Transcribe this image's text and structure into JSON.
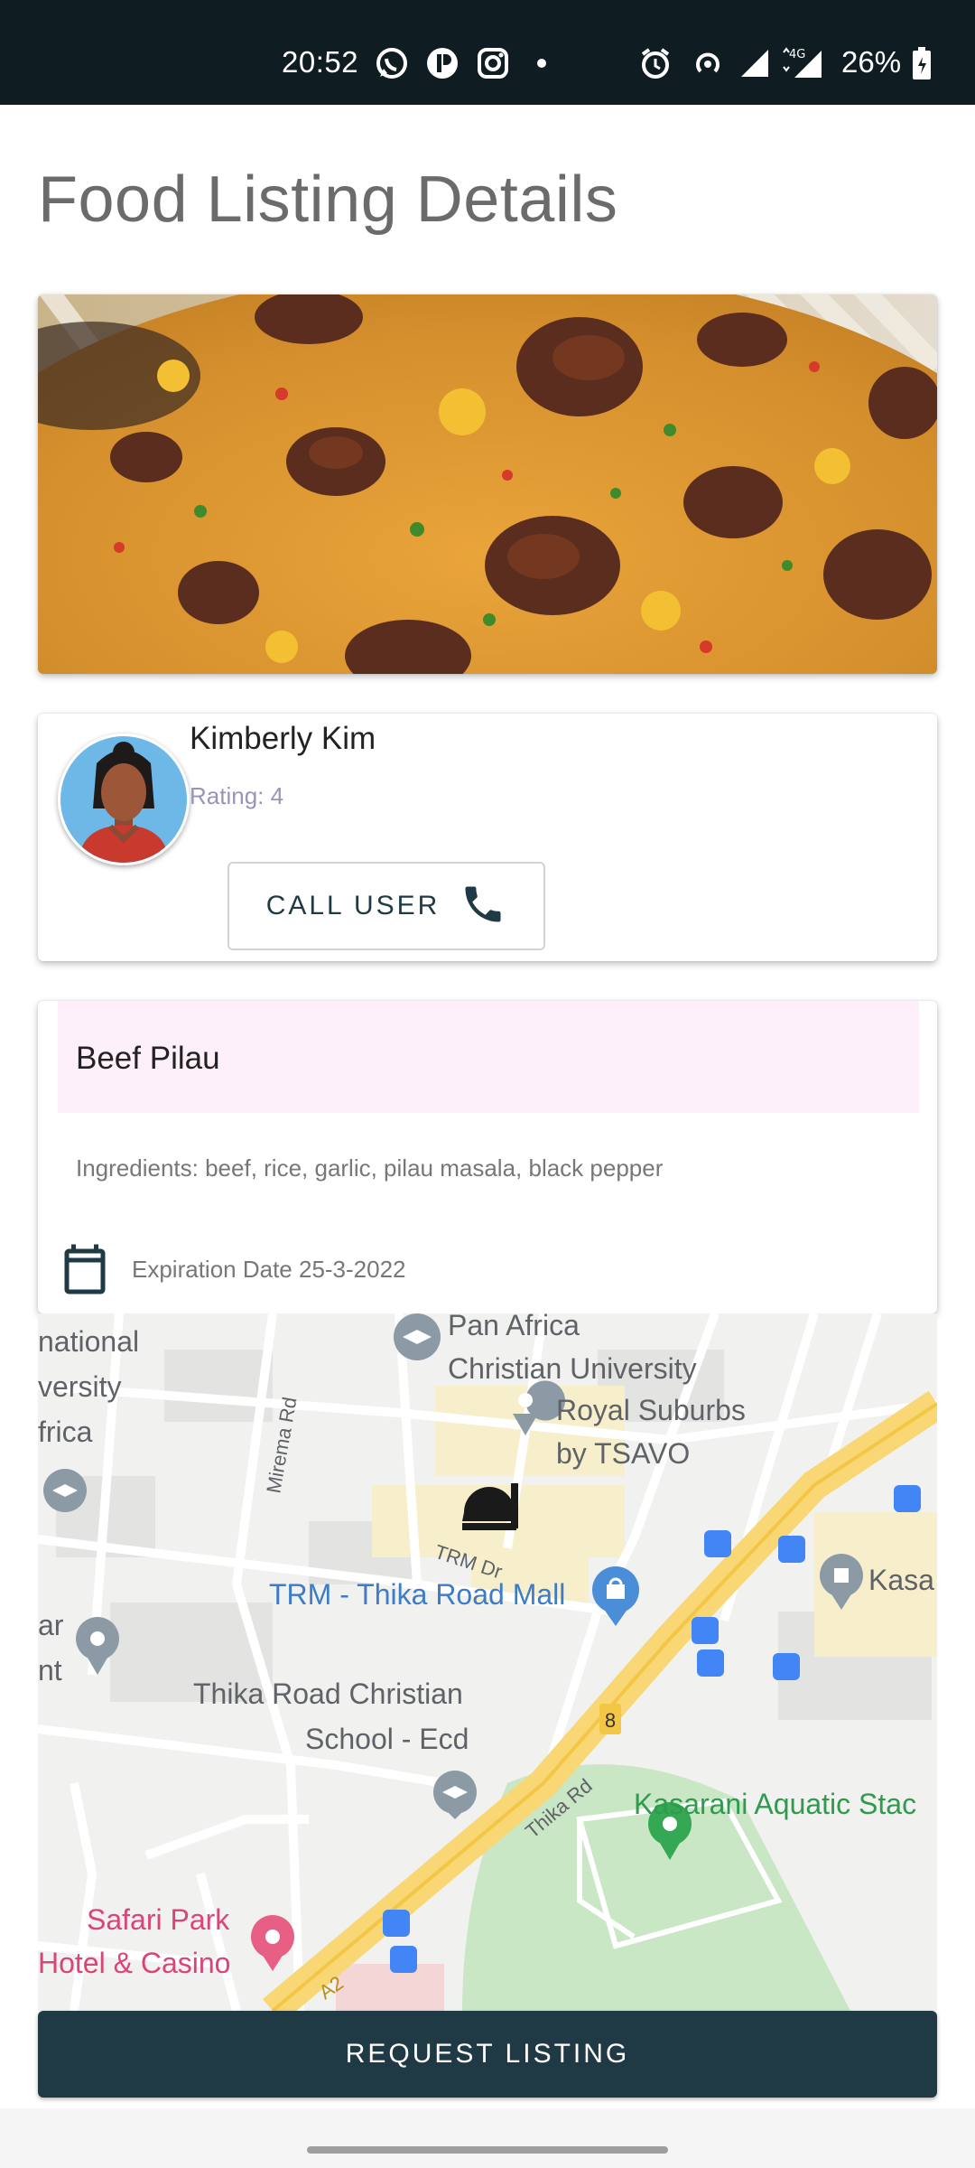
{
  "status_bar": {
    "time": "20:52",
    "battery": "26%",
    "network": "4G"
  },
  "page": {
    "title": "Food Listing Details"
  },
  "image": {
    "icon": "food-photo"
  },
  "user": {
    "name": "Kimberly Kim",
    "rating": "Rating: 4",
    "call_label": "CALL USER",
    "call_icon": "phone-icon"
  },
  "listing": {
    "name": "Beef Pilau",
    "ingredients": "Ingredients: beef, rice, garlic, pilau masala, black pepper",
    "expiry": "Expiration Date 25-3-2022",
    "expiry_icon": "calendar-icon"
  },
  "map": {
    "labels": {
      "university_a": "national",
      "university_b": "versity",
      "university_c": "frica",
      "pan_africa_1": "Pan Africa",
      "pan_africa_2": "Christian University",
      "royal_1": "Royal Suburbs",
      "royal_2": "by TSAVO",
      "mirema": "Mirema Rd",
      "trm_dr": "TRM Dr",
      "trm_mall": "TRM - Thika Road Mall",
      "kasa": "Kasa",
      "ar": "ar",
      "nt": "nt",
      "school_1": "Thika Road Christian",
      "school_2": "School - Ecd",
      "road_number": "8",
      "thika_rd": "Thika Rd",
      "kasarani": "Kasarani Aquatic Stac",
      "safari_1": "Safari Park",
      "safari_2": "Hotel & Casino",
      "a2": "A2"
    }
  },
  "actions": {
    "request_label": "REQUEST LISTING"
  },
  "colors": {
    "primary": "#1f3a45",
    "status_bar": "#0f1d23",
    "name_field_bg": "#fdf0fa"
  }
}
